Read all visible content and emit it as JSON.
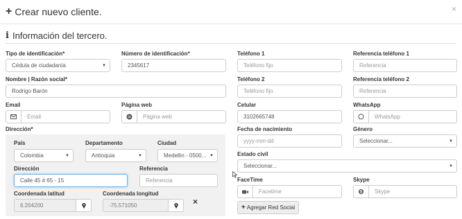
{
  "modal": {
    "title": "Crear nuevo cliente.",
    "close": "×"
  },
  "section": {
    "title": "Información del tercero."
  },
  "form": {
    "tipo_id": {
      "label": "Tipo de identificación*",
      "value": "Cédula de ciudadanía"
    },
    "numero_id": {
      "label": "Número de identificación*",
      "value": "2345617"
    },
    "nombre": {
      "label": "Nombre | Razón social*",
      "value": "Rodrigo Barón"
    },
    "email": {
      "label": "Email",
      "placeholder": "Email",
      "icon": "envelope-icon"
    },
    "pagina_web": {
      "label": "Página web",
      "placeholder": "Página web",
      "icon": "chrome-icon"
    },
    "direccion_label": "Dirección*",
    "telefono1": {
      "label": "Teléfono 1",
      "placeholder": "Teléfono fijo"
    },
    "ref_telefono1": {
      "label": "Referencia teléfono 1",
      "placeholder": "Referencia"
    },
    "telefono2": {
      "label": "Teléfono 2",
      "placeholder": "Teléfono fijo"
    },
    "ref_telefono2": {
      "label": "Referencia teléfono 2",
      "placeholder": "Referencia"
    },
    "celular": {
      "label": "Celular",
      "value": "3102665748"
    },
    "whatsapp": {
      "label": "WhatsApp",
      "placeholder": "WhatsApp",
      "icon": "whatsapp-icon"
    },
    "fecha_nacimiento": {
      "label": "Fecha de nacimiento",
      "placeholder": "yyyy-mm-dd"
    },
    "genero": {
      "label": "Género",
      "value": "Seleccionar..."
    },
    "estado_civil": {
      "label": "Estado civil",
      "value": "Seleccionar..."
    },
    "facetime": {
      "label": "FaceTime",
      "placeholder": "Facetime",
      "icon": "video-camera-icon"
    },
    "skype": {
      "label": "Skype",
      "placeholder": "Skype",
      "icon": "skype-icon"
    },
    "agregar_red_social": "Agregar Red Social"
  },
  "address": {
    "pais": {
      "label": "País",
      "value": "Colombia"
    },
    "departamento": {
      "label": "Departamento",
      "value": "Antioquia"
    },
    "ciudad": {
      "label": "Ciudad",
      "value": "Medellin - 0500..."
    },
    "direccion": {
      "label": "Dirección",
      "value": "Calle 45 # 65 - 15"
    },
    "referencia": {
      "label": "Referencia",
      "placeholder": "Referencia"
    },
    "latitud": {
      "label": "Coordenada latitud",
      "value": "6.204200"
    },
    "longitud": {
      "label": "Coordenada longitud",
      "value": "-75.571050"
    },
    "clear": "×"
  }
}
